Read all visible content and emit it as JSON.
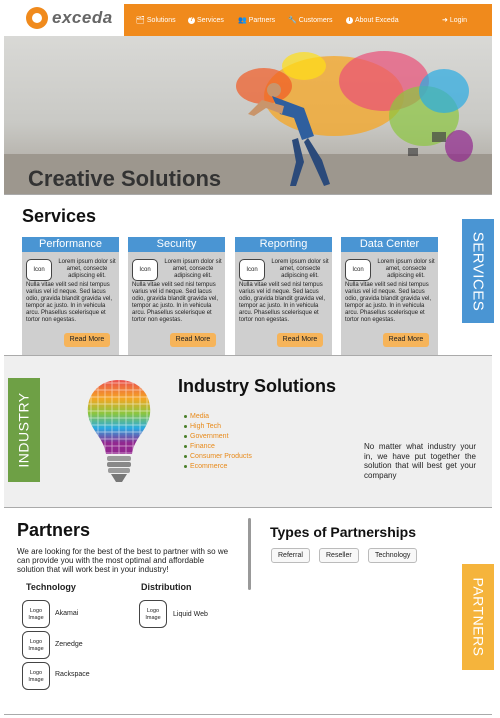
{
  "brand": {
    "name": "exceda"
  },
  "nav": [
    {
      "icon": "briefcase-icon",
      "glyph": "🗂",
      "label": "Solutions"
    },
    {
      "icon": "help-circle-icon",
      "glyph": "?",
      "label": "Services"
    },
    {
      "icon": "group-icon",
      "glyph": "👥",
      "label": "Partners"
    },
    {
      "icon": "wrench-icon",
      "glyph": "🔧",
      "label": "Customers"
    },
    {
      "icon": "info-circle-icon",
      "glyph": "i",
      "label": "About Exceda"
    },
    {
      "icon": "login-icon",
      "glyph": "➜",
      "label": "Login"
    }
  ],
  "hero": {
    "title": "Creative Solutions"
  },
  "services": {
    "title": "Services",
    "tab_label": "SERVICES",
    "tab_color": "#4a95d3",
    "cards": [
      {
        "name": "Performance",
        "icon_label": "Icon",
        "short": "Lorem ipsum dolor sit amet, consecte adipiscing elit.",
        "body": "Nulla vitae velit sed nisl tempus varius vel id neque. Sed lacus odio, gravida blandit gravida vel, tempor ac justo. In in vehicula arcu. Phasellus scelerisque et tortor non egestas.",
        "button": "Read More"
      },
      {
        "name": "Security",
        "icon_label": "Icon",
        "short": "Lorem ipsum dolor sit amet, consecte adipiscing elit.",
        "body": "Nulla vitae velit sed nisl tempus varius vel id neque. Sed lacus odio, gravida blandit gravida vel, tempor ac justo. In in vehicula arcu. Phasellus scelerisque et tortor non egestas.",
        "button": "Read More"
      },
      {
        "name": "Reporting",
        "icon_label": "Icon",
        "short": "Lorem ipsum dolor sit amet, consecte adipiscing elit.",
        "body": "Nulla vitae velit sed nisl tempus varius vel id neque. Sed lacus odio, gravida blandit gravida vel, tempor ac justo. In in vehicula arcu. Phasellus scelerisque et tortor non egestas.",
        "button": "Read More"
      },
      {
        "name": "Data Center",
        "icon_label": "Icon",
        "short": "Lorem ipsum dolor sit amet, consecte adipiscing elit.",
        "body": "Nulla vitae velit sed nisl tempus varius vel id neque. Sed lacus odio, gravida blandit gravida vel, tempor ac justo. In in vehicula arcu. Phasellus scelerisque et tortor non egestas.",
        "button": "Read More"
      }
    ]
  },
  "industry": {
    "tab_label": "INDUSTRY",
    "tab_color": "#6ea045",
    "title": "Industry Solutions",
    "items": [
      "Media",
      "High Tech",
      "Government",
      "Finance",
      "Consumer Products",
      "Ecommerce"
    ],
    "text": "No matter what industry your in, we have put together the solution that will best get your company"
  },
  "partners": {
    "title": "Partners",
    "description": "We are looking for the best of the best to partner with so we can provide you with the most optimal and affordable solution that will work best in your industry!",
    "technology_title": "Technology",
    "distribution_title": "Distribution",
    "logo_placeholder": "Logo Image",
    "technology": [
      "Akamai",
      "Zenedge",
      "Rackspace"
    ],
    "distribution": [
      "Liquid Web"
    ],
    "types_title": "Types of Partnerships",
    "types": [
      "Referral",
      "Reseller",
      "Technology"
    ],
    "tab_label": "PARTNERS",
    "tab_color": "#f5b43c"
  },
  "colors": {
    "accent": "#f08a1c",
    "button": "#f6b45a"
  }
}
